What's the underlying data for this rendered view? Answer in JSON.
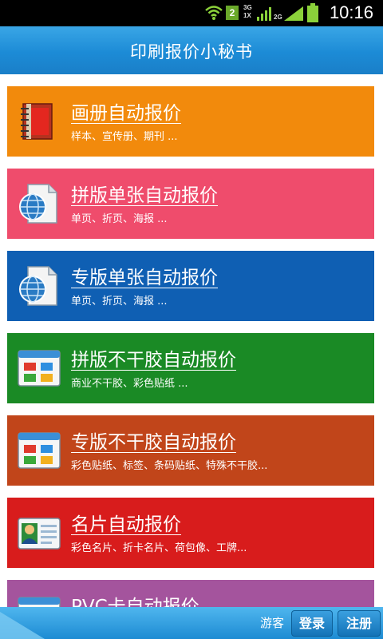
{
  "status_bar": {
    "time": "10:16",
    "notification_count": "2",
    "network_3g": "3G",
    "network_1x": "1X",
    "network_2g": "2G"
  },
  "header": {
    "title": "印刷报价小秘书"
  },
  "menu": [
    {
      "title": "画册自动报价",
      "subtitle": "样本、宣传册、期刊 ...",
      "color": "#f28a0c",
      "icon": "notebook-icon"
    },
    {
      "title": "拼版单张自动报价",
      "subtitle": "单页、折页、海报 ...",
      "color": "#ef4c6c",
      "icon": "globe-document-icon"
    },
    {
      "title": "专版单张自动报价",
      "subtitle": "单页、折页、海报 ...",
      "color": "#0f5fb3",
      "icon": "globe-document-icon"
    },
    {
      "title": "拼版不干胶自动报价",
      "subtitle": "商业不干胶、彩色贴纸 ...",
      "color": "#1a8a25",
      "icon": "window-tiles-icon"
    },
    {
      "title": "专版不干胶自动报价",
      "subtitle": "彩色贴纸、标签、条码贴纸、特殊不干胶...",
      "color": "#c1451a",
      "icon": "window-tiles-icon"
    },
    {
      "title": "名片自动报价",
      "subtitle": "彩色名片、折卡名片、荷包像、工牌...",
      "color": "#d81c1c",
      "icon": "business-card-icon"
    },
    {
      "title": "PVC卡自动报价",
      "subtitle": "",
      "color": "#a4549d",
      "icon": "window-tiles-icon"
    }
  ],
  "footer": {
    "guest_label": "游客",
    "login_label": "登录",
    "register_label": "注册"
  }
}
